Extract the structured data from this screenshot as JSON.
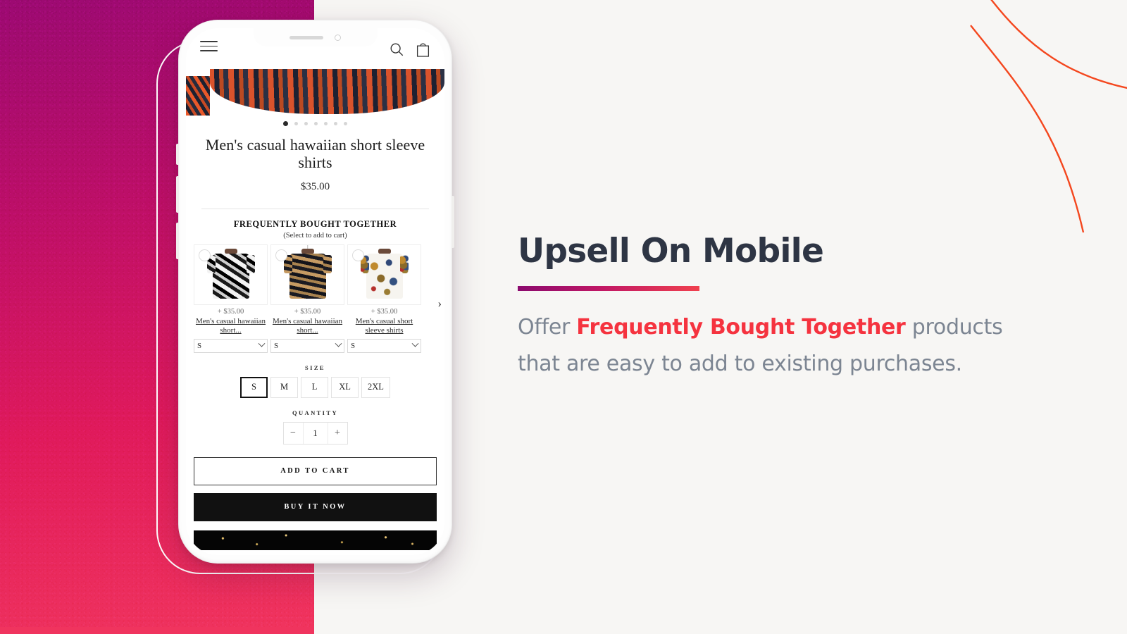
{
  "marketing": {
    "headline": "Upsell On Mobile",
    "body_prefix": "Offer ",
    "body_highlight": "Frequently Bought Together",
    "body_suffix": " products that are easy to add to existing purchases.",
    "accent_gradient_start": "#8b0a6e",
    "accent_gradient_end": "#f0404e",
    "headline_color": "#2e3544",
    "body_color": "#7c8592",
    "highlight_color": "#f5333f"
  },
  "background": {
    "left_panel_gradient_start": "#9c0a72",
    "left_panel_gradient_end": "#f0345e",
    "right_panel_color": "#f7f6f4",
    "curve_color": "#f4471e"
  },
  "phone": {
    "header": {
      "menu_icon": "hamburger-icon",
      "search_icon": "search-icon",
      "cart_icon": "shopping-bag-icon"
    },
    "gallery": {
      "dots_total": 7,
      "active_dot_index": 0
    },
    "product": {
      "title": "Men's casual hawaiian short sleeve shirts",
      "price": "$35.00"
    },
    "fbt": {
      "title": "FREQUENTLY BOUGHT TOGETHER",
      "subtitle": "(Select to add to cart)",
      "next_arrow": "›",
      "items": [
        {
          "price": "+ $35.00",
          "name": "Men's casual hawaiian short...",
          "size": "S",
          "checked": false
        },
        {
          "price": "+ $35.00",
          "name": "Men's casual hawaiian short...",
          "size": "S",
          "checked": false
        },
        {
          "price": "+ $35.00",
          "name": "Men's casual short sleeve shirts",
          "size": "S",
          "checked": false
        }
      ]
    },
    "size_selector": {
      "label": "SIZE",
      "options": [
        "S",
        "M",
        "L",
        "XL",
        "2XL"
      ],
      "selected": "S"
    },
    "quantity": {
      "label": "QUANTITY",
      "decrease": "−",
      "value": "1",
      "increase": "+"
    },
    "actions": {
      "add_to_cart": "ADD TO CART",
      "buy_it_now": "BUY IT NOW"
    }
  }
}
